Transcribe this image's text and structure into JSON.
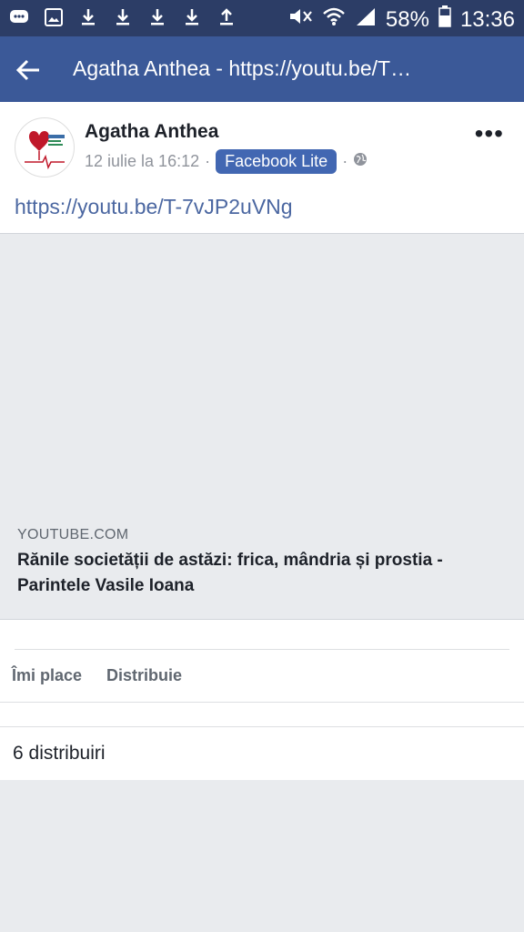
{
  "status_bar": {
    "battery": "58%",
    "time": "13:36",
    "icons_left": [
      "messenger-icon",
      "gallery-icon",
      "download-icon",
      "download-icon",
      "download-icon",
      "download-icon",
      "upload-icon"
    ],
    "icons_right": [
      "mute-icon",
      "wifi-icon",
      "signal-icon",
      "battery-icon"
    ]
  },
  "app_bar": {
    "title": "Agatha Anthea - https://youtu.be/T…"
  },
  "post": {
    "author": "Agatha Anthea",
    "date": "12 iulie la 16:12",
    "separator": "·",
    "app_badge": "Facebook Lite",
    "privacy_icon": "globe-icon",
    "link": "https://youtu.be/T-7vJP2uVNg",
    "preview": {
      "domain": "YOUTUBE.COM",
      "title": "Rănile societății de astăzi: frica, mândria și prostia - Parintele Vasile Ioana"
    }
  },
  "actions": {
    "like_label": "Îmi place",
    "share_label": "Distribuie"
  },
  "shares_text": "6 distribuiri",
  "colors": {
    "status_bar": "#2c3d66",
    "app_bar": "#3b5998",
    "badge": "#4267b2",
    "link": "#4b67a1"
  }
}
